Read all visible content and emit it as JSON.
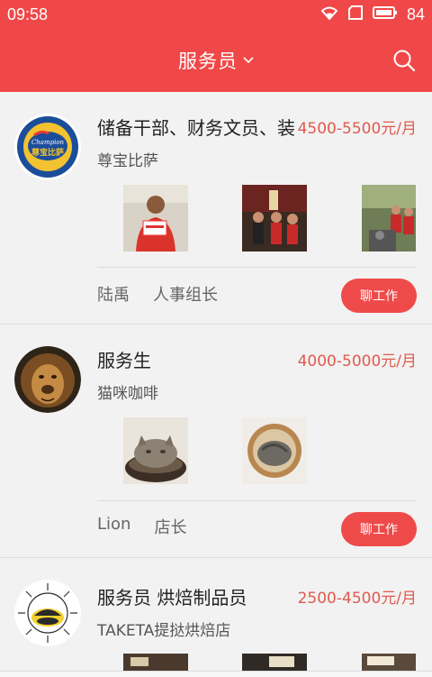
{
  "status_bar": {
    "time": "09:58",
    "battery": "84"
  },
  "header": {
    "title": "服务员"
  },
  "jobs": [
    {
      "title": "储备干部、财务文员、装..",
      "salary": "4500-5500元/月",
      "company": "尊宝比萨",
      "contact_name": "陆禹",
      "contact_role": "人事组长",
      "chat_label": "聊工作",
      "logo_text": "尊宝比萨"
    },
    {
      "title": "服务生",
      "salary": "4000-5000元/月",
      "company": "猫咪咖啡",
      "contact_name": "Lion",
      "contact_role": "店长",
      "chat_label": "聊工作"
    },
    {
      "title": "服务员 烘焙制品员",
      "salary": "2500-4500元/月",
      "company": "TAKETA提挞烘焙店"
    }
  ],
  "colors": {
    "brand": "#f04848",
    "salary": "#e05a4e",
    "button": "#ef4a4a"
  }
}
